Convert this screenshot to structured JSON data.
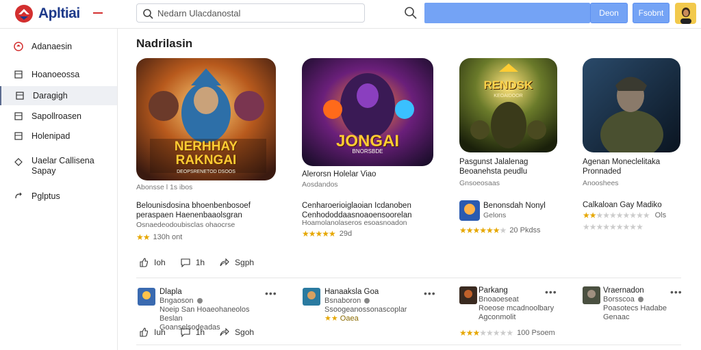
{
  "header": {
    "app_name": "Apltiai",
    "search_placeholder": "Nedarn Ulacdanostal",
    "button1": "Deon",
    "button2": "Fsobnt"
  },
  "sidebar": {
    "items": [
      {
        "label": "Adanaesin",
        "icon": "brand-circle-icon"
      },
      {
        "label": "Hoanoeossa",
        "icon": "list-icon"
      },
      {
        "label": "Daragigh",
        "icon": "list-icon"
      },
      {
        "label": "Sapollroasen",
        "icon": "list-icon"
      },
      {
        "label": "Holenipad",
        "icon": "list-icon"
      },
      {
        "label": "Uaelar Callisena",
        "label2": "Sapay",
        "icon": "diamond-icon"
      },
      {
        "label": "Pglptus",
        "icon": "link-icon"
      }
    ]
  },
  "main": {
    "section_title": "Nadrilasin",
    "featured": [
      {
        "art_title": "NERHHAY",
        "art_title2": "RAKNGAI",
        "art_sub": "DEOPSRENETOD DSOOS",
        "caption": "Abonsse l 1s ibos",
        "line1": "Belounisdosina bhoenbenbosoef",
        "line2": "peraspaen Haenenbaaolsgran",
        "line3": "Osnaedeodoubisclas ohaocrse",
        "rating_text": "130h ont",
        "stars": 2
      },
      {
        "art_title": "JONGAI",
        "art_sub": "BNORSBDE",
        "name": "Alerorsn Holelar Viao",
        "caption": "Aosdandos",
        "line1": "Cenharoerioiglaoian Icdanoben",
        "line2": "Cenhododdaasnoaoensoorelan",
        "line3": "Hoamolanolaseros esoasnoadon",
        "rating_text": "29d",
        "stars": 5
      },
      {
        "art_title": "RENDSK",
        "art_sub": "KEOAIDOOR",
        "name": "Pasgunst Jalalenag",
        "name2": "Beoanehsta peudlu",
        "caption": "Gnsoeosaas",
        "app_name": "Benonsdah Nonyl",
        "app_sub": "Gelons",
        "rating_text": "20 Pkdss",
        "stars": 5
      },
      {
        "name": "Agenan Moneclelitaka",
        "name2": "Pronnaded",
        "caption": "Anooshees",
        "app_name": "Calkaloan Gay Madiko",
        "rating_text": "Ols",
        "stars": 2
      }
    ],
    "actions_top": {
      "like": "Ioh",
      "comment": "1h",
      "share": "Sgph"
    },
    "actions_bottom": {
      "like": "Iuh",
      "comment": "1h",
      "share": "Sgoh"
    },
    "posts": [
      {
        "name": "Dlapla",
        "sub": "Bngaoson",
        "desc": "Noeip San Hoaeohaneolos Beslan",
        "desc2": "Goanselsodeadas"
      },
      {
        "name": "Hanaaksla Goa",
        "sub": "Bsnaboron",
        "desc": "Ssoogeanossonascoplar",
        "tag": "Oaea"
      },
      {
        "name": "Parkang",
        "sub": "Bnoaoeseat",
        "desc": "Roeose mcadnoolbary",
        "desc2": "Agconmolit",
        "rating_text": "100 Psoem",
        "stars": 3
      },
      {
        "name": "Vraernadon",
        "sub": "Borsscoa",
        "desc": "Poasotecs Hadabe",
        "desc2": "Genaac"
      }
    ]
  },
  "colors": {
    "accent": "#74a3f5",
    "brand": "#1e3a8a",
    "star": "#e6a700"
  }
}
